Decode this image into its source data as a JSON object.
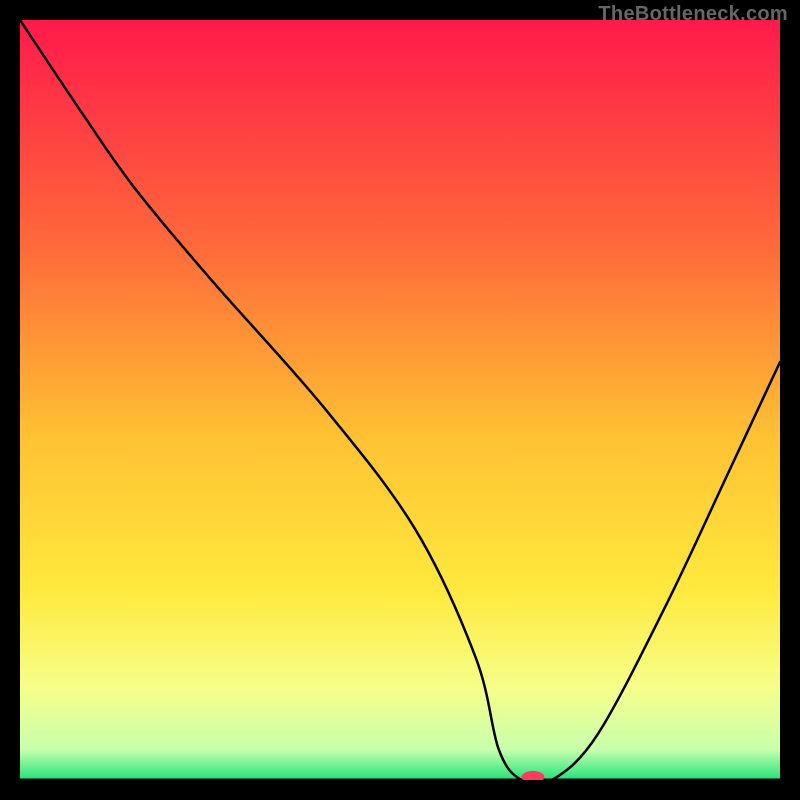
{
  "watermark": "TheBottleneck.com",
  "chart_data": {
    "type": "line",
    "title": "",
    "xlabel": "",
    "ylabel": "",
    "xlim": [
      0,
      100
    ],
    "ylim": [
      0,
      100
    ],
    "grid": false,
    "gradient_stops": [
      {
        "offset": 0.0,
        "color": "#ff1a4b"
      },
      {
        "offset": 0.3,
        "color": "#ff6a3a"
      },
      {
        "offset": 0.55,
        "color": "#ffc233"
      },
      {
        "offset": 0.75,
        "color": "#ffe93d"
      },
      {
        "offset": 0.88,
        "color": "#f6ff8a"
      },
      {
        "offset": 0.96,
        "color": "#c8ffad"
      },
      {
        "offset": 1.0,
        "color": "#22e27a"
      }
    ],
    "series": [
      {
        "name": "bottleneck-curve",
        "x": [
          0,
          8,
          15,
          25,
          40,
          52,
          60,
          63,
          66,
          70,
          76,
          85,
          93,
          100
        ],
        "y": [
          100,
          88,
          78,
          66,
          49,
          33,
          16,
          4,
          0,
          0,
          6,
          23,
          40,
          55
        ]
      }
    ],
    "marker": {
      "x": 67.5,
      "y": 0,
      "rx": 1.5,
      "ry": 0.8,
      "color": "#ff3b5c"
    },
    "baseline_y": 0
  }
}
